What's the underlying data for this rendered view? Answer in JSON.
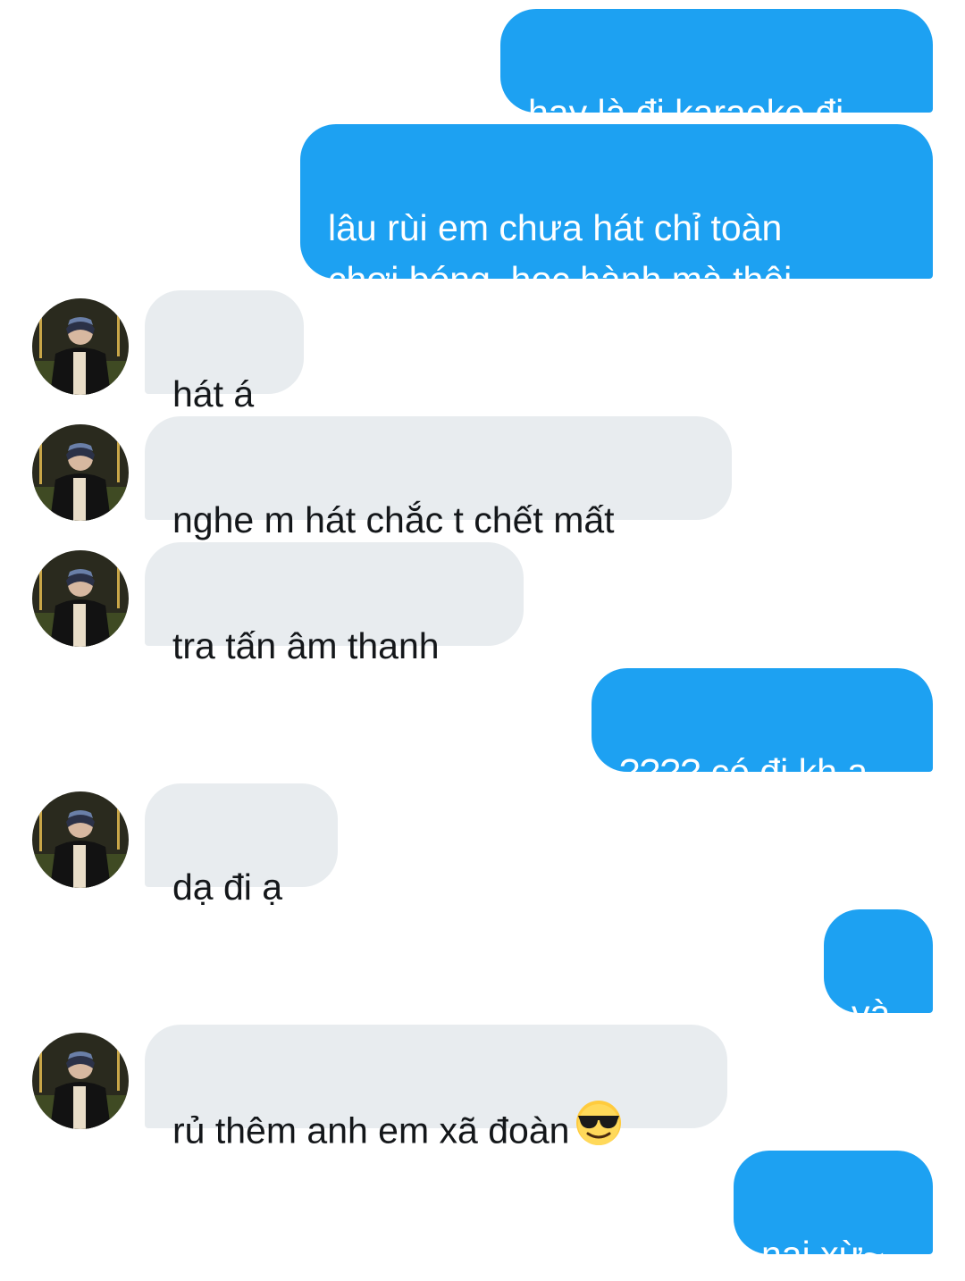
{
  "conversation": {
    "messages": [
      {
        "sender": "me",
        "text": "hay là đi karaoke đi"
      },
      {
        "sender": "me",
        "text": "lâu rùi em chưa hát chỉ toàn\nchơi bóng, học hành mà thôi"
      },
      {
        "sender": "them",
        "text": "hát á"
      },
      {
        "sender": "them",
        "text": "nghe m hát chắc t chết mất"
      },
      {
        "sender": "them",
        "text": "tra tấn âm thanh"
      },
      {
        "sender": "me",
        "text": "???? có đi kh ạ"
      },
      {
        "sender": "them",
        "text": "dạ đi ạ"
      },
      {
        "sender": "me",
        "text": "và"
      },
      {
        "sender": "them",
        "text": "rủ thêm anh em xã đoàn",
        "emoji": "smiling-face-with-sunglasses"
      },
      {
        "sender": "me",
        "text": "nai xừ~"
      }
    ]
  },
  "colors": {
    "outgoing_bubble": "#1da1f2",
    "incoming_bubble": "#e8ecef",
    "incoming_text": "#14171a"
  }
}
